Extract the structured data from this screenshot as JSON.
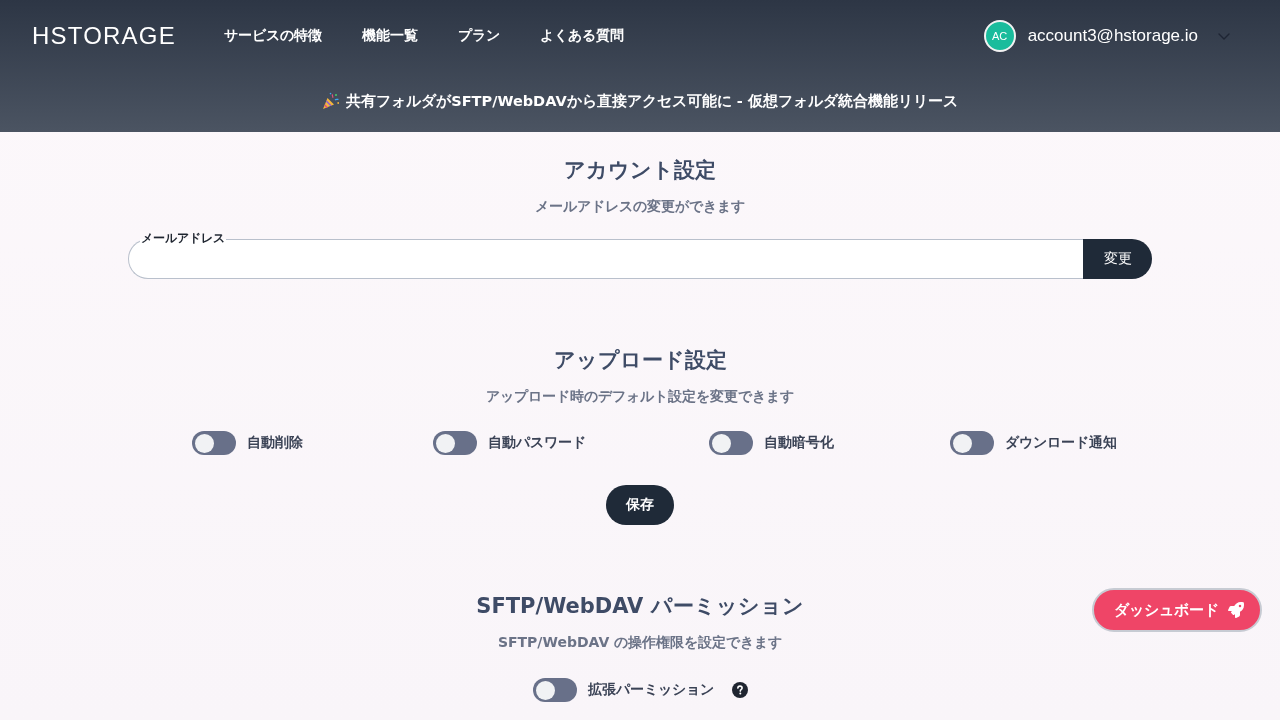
{
  "header": {
    "logo": "HSTORAGE",
    "nav": [
      "サービスの特徴",
      "機能一覧",
      "プラン",
      "よくある質問"
    ],
    "account": {
      "initials": "AC",
      "email": "account3@hstorage.io"
    },
    "announcement": "共有フォルダがSFTP/WebDAVから直接アクセス可能に - 仮想フォルダ統合機能リリース"
  },
  "sections": [
    {
      "kind": "email",
      "title": "アカウント設定",
      "subtitle": "メールアドレスの変更ができます",
      "field": {
        "label": "メールアドレス"
      },
      "button": "変更"
    },
    {
      "kind": "toggles",
      "title": "アップロード設定",
      "subtitle": "アップロード時のデフォルト設定を変更できます",
      "toggles": [
        {
          "label": "自動削除",
          "on": false
        },
        {
          "label": "自動パスワード",
          "on": false
        },
        {
          "label": "自動暗号化",
          "on": false
        },
        {
          "label": "ダウンロード通知",
          "on": false
        }
      ],
      "button": "保存"
    },
    {
      "kind": "permission",
      "title": "SFTP/WebDAV パーミッション",
      "subtitle": "SFTP/WebDAV の操作権限を設定できます",
      "toggles": [
        {
          "label": "拡張パーミッション",
          "on": false,
          "help": true
        }
      ]
    }
  ],
  "floating_button": {
    "label": "ダッシュボード"
  }
}
